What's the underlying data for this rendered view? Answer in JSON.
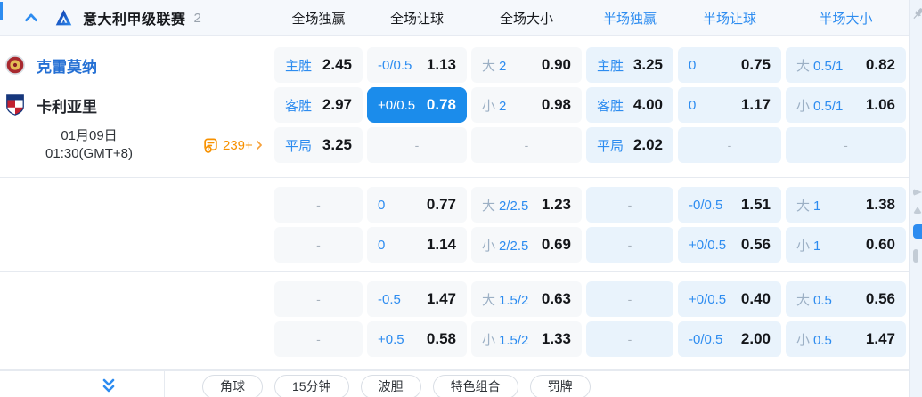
{
  "header": {
    "league_name": "意大利甲级联赛",
    "match_count": "2",
    "collapse_icon": "chevron-up",
    "pin_icon": "pushpin",
    "columns": [
      {
        "label": "全场独赢",
        "half": false
      },
      {
        "label": "全场让球",
        "half": false
      },
      {
        "label": "全场大小",
        "half": false
      },
      {
        "label": "半场独赢",
        "half": true
      },
      {
        "label": "半场让球",
        "half": true
      },
      {
        "label": "半场大小",
        "half": true
      }
    ]
  },
  "match": {
    "home_name": "克雷莫纳",
    "away_name": "卡利亚里",
    "date": "01月09日",
    "time": "01:30(GMT+8)",
    "more_markets_count": "239+"
  },
  "odds_rows": [
    {
      "cells": [
        {
          "lb": "主胜",
          "v": "2.45"
        },
        {
          "lb": "-0/0.5",
          "v": "1.13"
        },
        {
          "lg": "大",
          "lb": "2",
          "v": "0.90"
        },
        {
          "lb": "主胜",
          "v": "3.25"
        },
        {
          "lb": "0",
          "v": "0.75"
        },
        {
          "lg": "大",
          "lb": "0.5/1",
          "v": "0.82"
        }
      ]
    },
    {
      "cells": [
        {
          "lb": "客胜",
          "v": "2.97"
        },
        {
          "lb": "+0/0.5",
          "v": "0.78",
          "hl": true
        },
        {
          "lg": "小",
          "lb": "2",
          "v": "0.98"
        },
        {
          "lb": "客胜",
          "v": "4.00"
        },
        {
          "lb": "0",
          "v": "1.17"
        },
        {
          "lg": "小",
          "lb": "0.5/1",
          "v": "1.06"
        }
      ]
    },
    {
      "cells": [
        {
          "lb": "平局",
          "v": "3.25"
        },
        {
          "v": "-"
        },
        {
          "v": "-"
        },
        {
          "lb": "平局",
          "v": "2.02"
        },
        {
          "v": "-"
        },
        {
          "v": "-"
        }
      ]
    },
    {
      "cells": [
        {
          "v": "-"
        },
        {
          "lb": "0",
          "v": "0.77"
        },
        {
          "lg": "大",
          "lb": "2/2.5",
          "v": "1.23"
        },
        {
          "v": "-"
        },
        {
          "lb": "-0/0.5",
          "v": "1.51"
        },
        {
          "lg": "大",
          "lb": "1",
          "v": "1.38"
        }
      ]
    },
    {
      "cells": [
        {
          "v": "-"
        },
        {
          "lb": "0",
          "v": "1.14"
        },
        {
          "lg": "小",
          "lb": "2/2.5",
          "v": "0.69"
        },
        {
          "v": "-"
        },
        {
          "lb": "+0/0.5",
          "v": "0.56"
        },
        {
          "lg": "小",
          "lb": "1",
          "v": "0.60"
        }
      ]
    },
    {
      "cells": [
        {
          "v": "-"
        },
        {
          "lb": "-0.5",
          "v": "1.47"
        },
        {
          "lg": "大",
          "lb": "1.5/2",
          "v": "0.63"
        },
        {
          "v": "-"
        },
        {
          "lb": "+0/0.5",
          "v": "0.40"
        },
        {
          "lg": "大",
          "lb": "0.5",
          "v": "0.56"
        }
      ]
    },
    {
      "cells": [
        {
          "v": "-"
        },
        {
          "lb": "+0.5",
          "v": "0.58"
        },
        {
          "lg": "小",
          "lb": "1.5/2",
          "v": "1.33"
        },
        {
          "v": "-"
        },
        {
          "lb": "-0/0.5",
          "v": "2.00"
        },
        {
          "lg": "小",
          "lb": "0.5",
          "v": "1.47"
        }
      ]
    }
  ],
  "footer": {
    "expand_icon": "double-chevron-down",
    "markets": [
      "角球",
      "15分钟",
      "波胆",
      "特色组合",
      "罚牌"
    ]
  },
  "colors": {
    "accent_blue": "#2d8cf0",
    "highlight_cell_bg": "#1b8ceb",
    "half_cell_bg": "#e9f3fc",
    "full_cell_bg": "#f6f8fa",
    "home_team_blue": "#2570d4",
    "markets_orange": "#f79100"
  }
}
